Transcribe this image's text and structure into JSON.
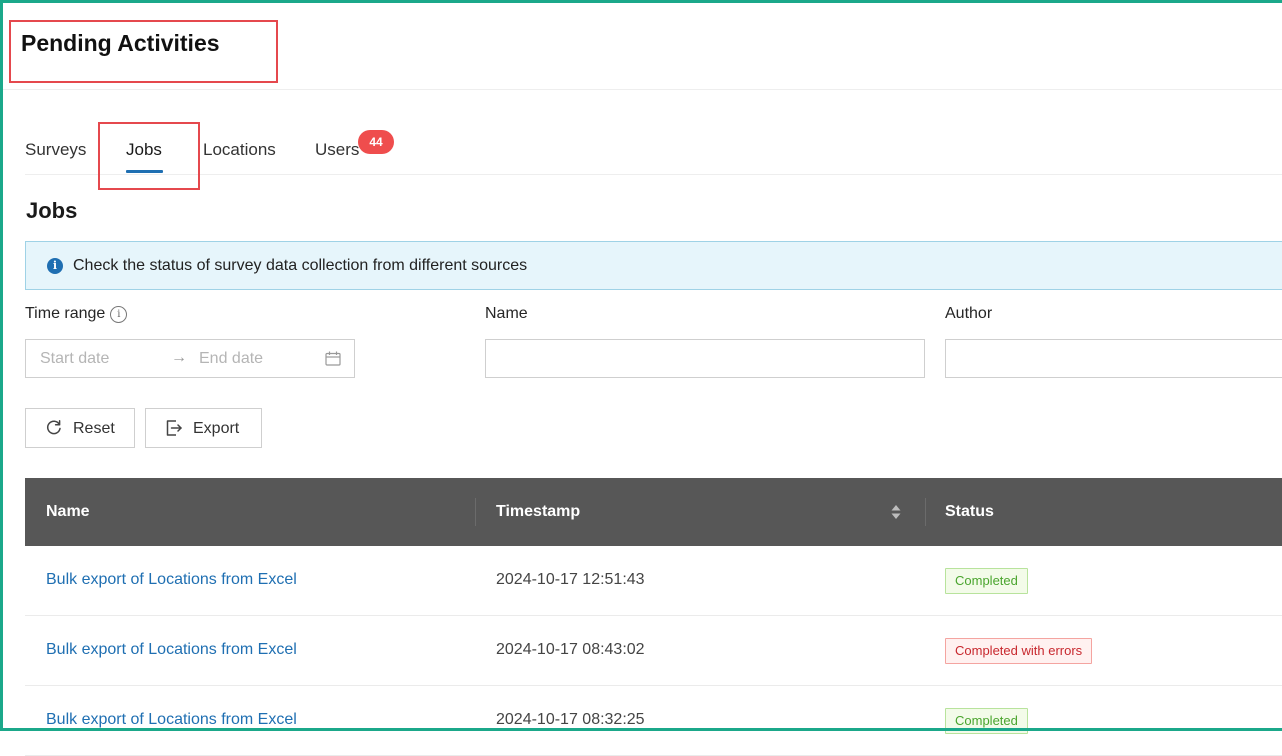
{
  "page": {
    "title": "Pending Activities"
  },
  "tabs": [
    {
      "label": "Surveys",
      "active": false
    },
    {
      "label": "Jobs",
      "active": true
    },
    {
      "label": "Locations",
      "active": false
    },
    {
      "label": "Users",
      "active": false,
      "badge": "44"
    }
  ],
  "section": {
    "title": "Jobs"
  },
  "info_banner": {
    "icon": "info-icon",
    "text": "Check the status of survey data collection from different sources"
  },
  "filters": {
    "time_range": {
      "label": "Time range",
      "hint_icon": "info-circle-icon",
      "start_placeholder": "Start date",
      "end_placeholder": "End date",
      "separator": "→",
      "calendar_icon": "calendar-icon"
    },
    "name": {
      "label": "Name",
      "value": ""
    },
    "author": {
      "label": "Author",
      "value": ""
    }
  },
  "actions": {
    "reset": {
      "label": "Reset",
      "icon": "reload-icon"
    },
    "export": {
      "label": "Export",
      "icon": "export-icon"
    }
  },
  "table": {
    "columns": [
      "Name",
      "Timestamp",
      "Status"
    ],
    "rows": [
      {
        "name": "Bulk export of Locations from Excel",
        "timestamp": "2024-10-17 12:51:43",
        "status": "Completed"
      },
      {
        "name": "Bulk export of Locations from Excel",
        "timestamp": "2024-10-17 08:43:02",
        "status": "Completed with errors"
      },
      {
        "name": "Bulk export of Locations from Excel",
        "timestamp": "2024-10-17 08:32:25",
        "status": "Completed"
      }
    ]
  },
  "colors": {
    "accent": "#1f6fb2",
    "badge": "#ef4d4d",
    "highlight": "#e5484d",
    "frame": "#1ba88a",
    "table_header": "#575757",
    "status_ok": "#4aa52e",
    "status_error": "#c8282e"
  }
}
